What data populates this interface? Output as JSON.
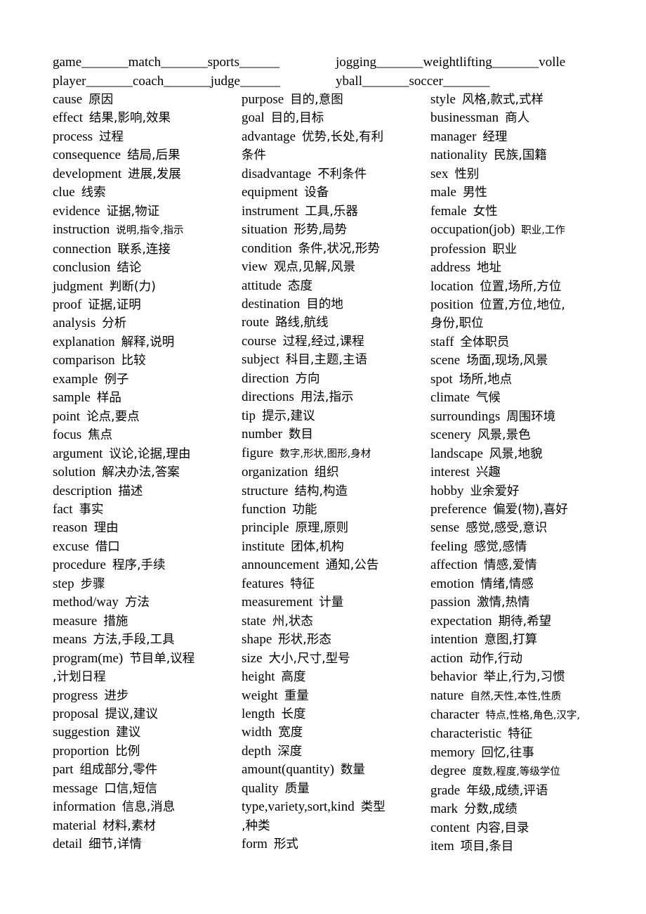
{
  "header": {
    "row1": [
      "game_______match_______sports______",
      "jogging_______weightlifting_______volle"
    ],
    "row2": [
      "player_______coach_______judge______",
      "yball_______soccer_______"
    ]
  },
  "columns": [
    {
      "entries": [
        {
          "en": "cause",
          "zh": "原因"
        },
        {
          "en": "effect",
          "zh": "结果,影响,效果"
        },
        {
          "en": "process",
          "zh": "过程"
        },
        {
          "en": "consequence",
          "zh": "结局,后果"
        },
        {
          "en": "development",
          "zh": "进展,发展"
        },
        {
          "en": "clue",
          "zh": "线索"
        },
        {
          "en": "evidence",
          "zh": "证据,物证"
        },
        {
          "en": "instruction",
          "zh": "说明,指令,指示",
          "small": true
        },
        {
          "en": "connection",
          "zh": "联系,连接"
        },
        {
          "en": "conclusion",
          "zh": "结论"
        },
        {
          "en": "judgment",
          "zh": "判断(力)"
        },
        {
          "en": "proof",
          "zh": "证据,证明"
        },
        {
          "en": "analysis",
          "zh": "分析"
        },
        {
          "en": "explanation",
          "zh": "解释,说明"
        },
        {
          "en": "comparison",
          "zh": "比较"
        },
        {
          "en": "example",
          "zh": "例子"
        },
        {
          "en": "sample",
          "zh": "样品"
        },
        {
          "en": "point",
          "zh": "论点,要点"
        },
        {
          "en": "focus",
          "zh": "焦点"
        },
        {
          "en": "argument",
          "zh": "议论,论据,理由"
        },
        {
          "en": "solution",
          "zh": "解决办法,答案"
        },
        {
          "en": "description",
          "zh": "描述"
        },
        {
          "en": "fact",
          "zh": "事实"
        },
        {
          "en": "reason",
          "zh": "理由"
        },
        {
          "en": "excuse",
          "zh": "借口"
        },
        {
          "en": "procedure",
          "zh": "程序,手续"
        },
        {
          "en": "step",
          "zh": "步骤"
        },
        {
          "en": "method/way",
          "zh": "方法"
        },
        {
          "en": "measure",
          "zh": "措施"
        },
        {
          "en": "means",
          "zh": "方法,手段,工具"
        },
        {
          "en": "program(me)",
          "zh": "节目单,议程",
          "cont": ",计划日程"
        },
        {
          "en": "progress",
          "zh": "进步"
        },
        {
          "en": "proposal",
          "zh": "提议,建议"
        },
        {
          "en": "suggestion",
          "zh": "建议"
        },
        {
          "en": "proportion",
          "zh": "比例"
        },
        {
          "en": "part",
          "zh": "组成部分,零件"
        },
        {
          "en": "message",
          "zh": "口信,短信"
        },
        {
          "en": "information",
          "zh": "信息,消息"
        },
        {
          "en": "material",
          "zh": "材料,素材"
        },
        {
          "en": "detail",
          "zh": "细节,详情"
        }
      ]
    },
    {
      "entries": [
        {
          "en": "purpose",
          "zh": "目的,意图"
        },
        {
          "en": "goal",
          "zh": "目的,目标"
        },
        {
          "en": "advantage",
          "zh": "优势,长处,有利",
          "cont": "条件"
        },
        {
          "en": "disadvantage",
          "zh": "不利条件"
        },
        {
          "en": "equipment",
          "zh": "设备"
        },
        {
          "en": "instrument",
          "zh": "工具,乐器"
        },
        {
          "en": "situation",
          "zh": "形势,局势"
        },
        {
          "en": "condition",
          "zh": "条件,状况,形势"
        },
        {
          "en": "view",
          "zh": "观点,见解,风景"
        },
        {
          "en": "attitude",
          "zh": "态度"
        },
        {
          "en": "destination",
          "zh": "目的地"
        },
        {
          "en": "route",
          "zh": "路线,航线"
        },
        {
          "en": "course",
          "zh": "过程,经过,课程"
        },
        {
          "en": "subject",
          "zh": "科目,主题,主语"
        },
        {
          "en": "direction",
          "zh": "方向"
        },
        {
          "en": "directions",
          "zh": "用法,指示"
        },
        {
          "en": "tip",
          "zh": "提示,建议"
        },
        {
          "en": "number",
          "zh": "数目"
        },
        {
          "en": "figure",
          "zh": "数字,形状,图形,身材",
          "small": true
        },
        {
          "en": "organization",
          "zh": "组织"
        },
        {
          "en": "structure",
          "zh": "结构,构造"
        },
        {
          "en": "function",
          "zh": "功能"
        },
        {
          "en": "principle",
          "zh": "原理,原则"
        },
        {
          "en": "institute",
          "zh": "团体,机构"
        },
        {
          "en": "announcement",
          "zh": "通知,公告"
        },
        {
          "en": "features",
          "zh": "特征"
        },
        {
          "en": "measurement",
          "zh": "计量"
        },
        {
          "en": "state",
          "zh": "州,状态"
        },
        {
          "en": "shape",
          "zh": "形状,形态"
        },
        {
          "en": "size",
          "zh": "大小,尺寸,型号"
        },
        {
          "en": "height",
          "zh": "高度"
        },
        {
          "en": "weight",
          "zh": "重量"
        },
        {
          "en": "length",
          "zh": "长度"
        },
        {
          "en": "width",
          "zh": "宽度"
        },
        {
          "en": "depth",
          "zh": "深度"
        },
        {
          "en": "amount(quantity)",
          "zh": "数量"
        },
        {
          "en": "quality",
          "zh": "质量"
        },
        {
          "en": "type,variety,sort,kind",
          "zh": "类型",
          "cont": ",种类"
        },
        {
          "en": "form",
          "zh": "形式"
        }
      ]
    },
    {
      "entries": [
        {
          "en": "style",
          "zh": "风格,款式,式样"
        },
        {
          "en": "businessman",
          "zh": "商人"
        },
        {
          "en": "manager",
          "zh": "经理"
        },
        {
          "en": "nationality",
          "zh": "民族,国籍"
        },
        {
          "en": "sex",
          "zh": "性别"
        },
        {
          "en": "male",
          "zh": "男性"
        },
        {
          "en": "female",
          "zh": "女性"
        },
        {
          "en": "occupation(job)",
          "zh": "职业,工作",
          "small": true
        },
        {
          "en": "profession",
          "zh": "职业"
        },
        {
          "en": "address",
          "zh": "地址"
        },
        {
          "en": "location",
          "zh": "位置,场所,方位"
        },
        {
          "en": "position",
          "zh": "位置,方位,地位,",
          "cont": "身份,职位"
        },
        {
          "en": "staff",
          "zh": "全体职员"
        },
        {
          "en": "scene",
          "zh": "场面,现场,风景"
        },
        {
          "en": "spot",
          "zh": "场所,地点"
        },
        {
          "en": "climate",
          "zh": "气候"
        },
        {
          "en": "surroundings",
          "zh": "周围环境"
        },
        {
          "en": "scenery",
          "zh": "风景,景色"
        },
        {
          "en": "landscape",
          "zh": "风景,地貌"
        },
        {
          "en": "interest",
          "zh": "兴趣"
        },
        {
          "en": "hobby",
          "zh": "业余爱好"
        },
        {
          "en": "preference",
          "zh": "偏爱(物),喜好"
        },
        {
          "en": "sense",
          "zh": "感觉,感受,意识"
        },
        {
          "en": "feeling",
          "zh": "感觉,感情"
        },
        {
          "en": "affection",
          "zh": "情感,爱情"
        },
        {
          "en": "emotion",
          "zh": "情绪,情感"
        },
        {
          "en": "passion",
          "zh": "激情,热情"
        },
        {
          "en": "expectation",
          "zh": "期待,希望"
        },
        {
          "en": "intention",
          "zh": "意图,打算"
        },
        {
          "en": "action",
          "zh": "动作,行动"
        },
        {
          "en": "behavior",
          "zh": "举止,行为,习惯"
        },
        {
          "en": "nature",
          "zh": "自然,天性,本性,性质",
          "small": true
        },
        {
          "en": "character",
          "zh": "特点,性格,角色,汉字,",
          "small": true
        },
        {
          "en": "characteristic",
          "zh": "特征"
        },
        {
          "en": "memory",
          "zh": "回忆,往事"
        },
        {
          "en": "degree",
          "zh": "度数,程度,等级学位",
          "small": true
        },
        {
          "en": "grade",
          "zh": "年级,成绩,评语"
        },
        {
          "en": "mark",
          "zh": "分数,成绩"
        },
        {
          "en": "content",
          "zh": "内容,目录"
        },
        {
          "en": "item",
          "zh": "项目,条目"
        }
      ]
    }
  ]
}
